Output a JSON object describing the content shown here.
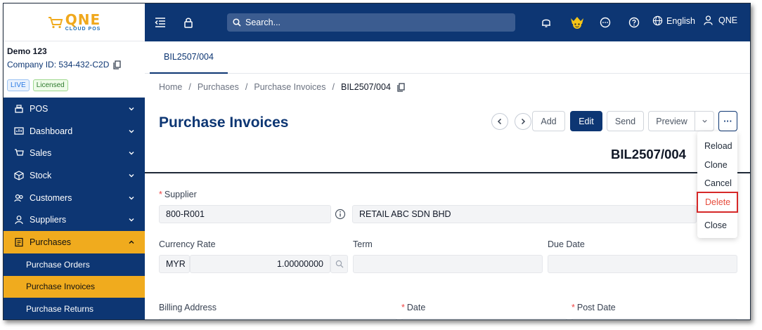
{
  "brand": {
    "logo_big": "QNE",
    "logo_small": "CLOUD POS"
  },
  "company": {
    "name": "Demo 123",
    "id": "Company ID: 534-432-C2D",
    "badge_live": "LIVE",
    "badge_licensed": "Licensed"
  },
  "sidebar": {
    "items": [
      {
        "label": "POS",
        "icon": "pos-icon"
      },
      {
        "label": "Dashboard",
        "icon": "dashboard-icon"
      },
      {
        "label": "Sales",
        "icon": "sales-icon"
      },
      {
        "label": "Stock",
        "icon": "stock-icon"
      },
      {
        "label": "Customers",
        "icon": "customers-icon"
      },
      {
        "label": "Suppliers",
        "icon": "suppliers-icon"
      },
      {
        "label": "Purchases",
        "icon": "purchases-icon"
      }
    ],
    "sub_items": [
      {
        "label": "Purchase Orders"
      },
      {
        "label": "Purchase Invoices"
      },
      {
        "label": "Purchase Returns"
      }
    ]
  },
  "topbar": {
    "search_placeholder": "Search...",
    "language": "English",
    "user": "QNE"
  },
  "tabs": [
    {
      "label": "BIL2507/004"
    }
  ],
  "breadcrumb": {
    "home": "Home",
    "purchases": "Purchases",
    "purchase_invoices": "Purchase Invoices",
    "current": "BIL2507/004"
  },
  "page": {
    "title": "Purchase Invoices",
    "doc_number": "BIL2507/004"
  },
  "toolbar": {
    "add": "Add",
    "edit": "Edit",
    "send": "Send",
    "preview": "Preview",
    "more": "···"
  },
  "dropdown": {
    "reload": "Reload",
    "clone": "Clone",
    "cancel": "Cancel",
    "delete": "Delete",
    "close": "Close"
  },
  "form": {
    "supplier_label": "Supplier",
    "supplier_code": "800-R001",
    "supplier_name": "RETAIL ABC SDN BHD",
    "currency_rate_label": "Currency Rate",
    "currency": "MYR",
    "rate": "1.00000000",
    "term_label": "Term",
    "term_value": "",
    "due_date_label": "Due Date",
    "due_date_value": "",
    "billing_address_label": "Billing Address",
    "date_label": "Date",
    "post_date_label": "Post Date"
  },
  "colors": {
    "primary": "#0d3673",
    "accent": "#f0ab1e",
    "danger": "#e74c3c"
  }
}
